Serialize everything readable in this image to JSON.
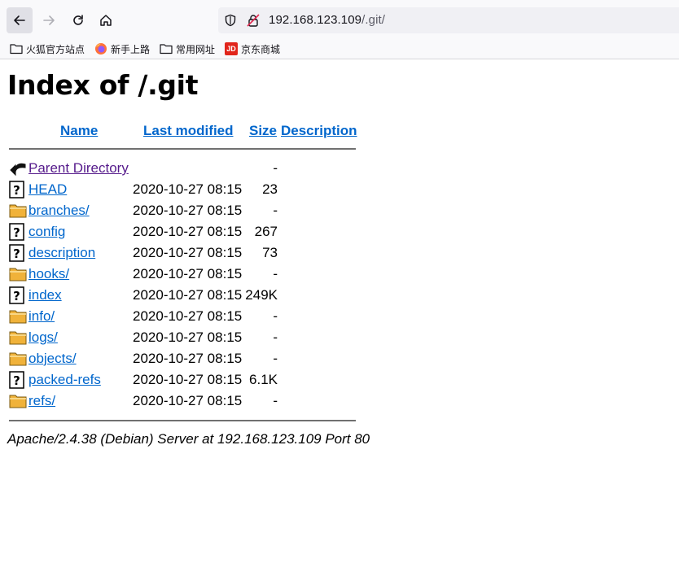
{
  "browser": {
    "url_host": "192.168.123.109",
    "url_path": "/.git/",
    "bookmarks": [
      {
        "label": "火狐官方站点",
        "icon": "folder-icon"
      },
      {
        "label": "新手上路",
        "icon": "firefox-icon"
      },
      {
        "label": "常用网址",
        "icon": "folder-icon"
      },
      {
        "label": "京东商城",
        "icon": "jd-icon",
        "icon_text": "JD"
      }
    ]
  },
  "page": {
    "title": "Index of /.git",
    "columns": {
      "name": "Name",
      "modified": "Last modified",
      "size": "Size",
      "description": "Description"
    },
    "entries": [
      {
        "name": "Parent Directory",
        "modified": "",
        "size": "-",
        "icon": "back-icon"
      },
      {
        "name": "HEAD",
        "modified": "2020-10-27 08:15",
        "size": "23",
        "icon": "unknown-file-icon"
      },
      {
        "name": "branches/",
        "modified": "2020-10-27 08:15",
        "size": "-",
        "icon": "folder-icon"
      },
      {
        "name": "config",
        "modified": "2020-10-27 08:15",
        "size": "267",
        "icon": "unknown-file-icon"
      },
      {
        "name": "description",
        "modified": "2020-10-27 08:15",
        "size": "73",
        "icon": "unknown-file-icon"
      },
      {
        "name": "hooks/",
        "modified": "2020-10-27 08:15",
        "size": "-",
        "icon": "folder-icon"
      },
      {
        "name": "index",
        "modified": "2020-10-27 08:15",
        "size": "249K",
        "icon": "unknown-file-icon"
      },
      {
        "name": "info/",
        "modified": "2020-10-27 08:15",
        "size": "-",
        "icon": "folder-icon"
      },
      {
        "name": "logs/",
        "modified": "2020-10-27 08:15",
        "size": "-",
        "icon": "folder-icon"
      },
      {
        "name": "objects/",
        "modified": "2020-10-27 08:15",
        "size": "-",
        "icon": "folder-icon"
      },
      {
        "name": "packed-refs",
        "modified": "2020-10-27 08:15",
        "size": "6.1K",
        "icon": "unknown-file-icon"
      },
      {
        "name": "refs/",
        "modified": "2020-10-27 08:15",
        "size": "-",
        "icon": "folder-icon"
      }
    ],
    "footer": "Apache/2.4.38 (Debian) Server at 192.168.123.109 Port 80"
  },
  "colors": {
    "link": "#0066cc",
    "visited": "#551a8b",
    "folder": "#f0b23a"
  }
}
